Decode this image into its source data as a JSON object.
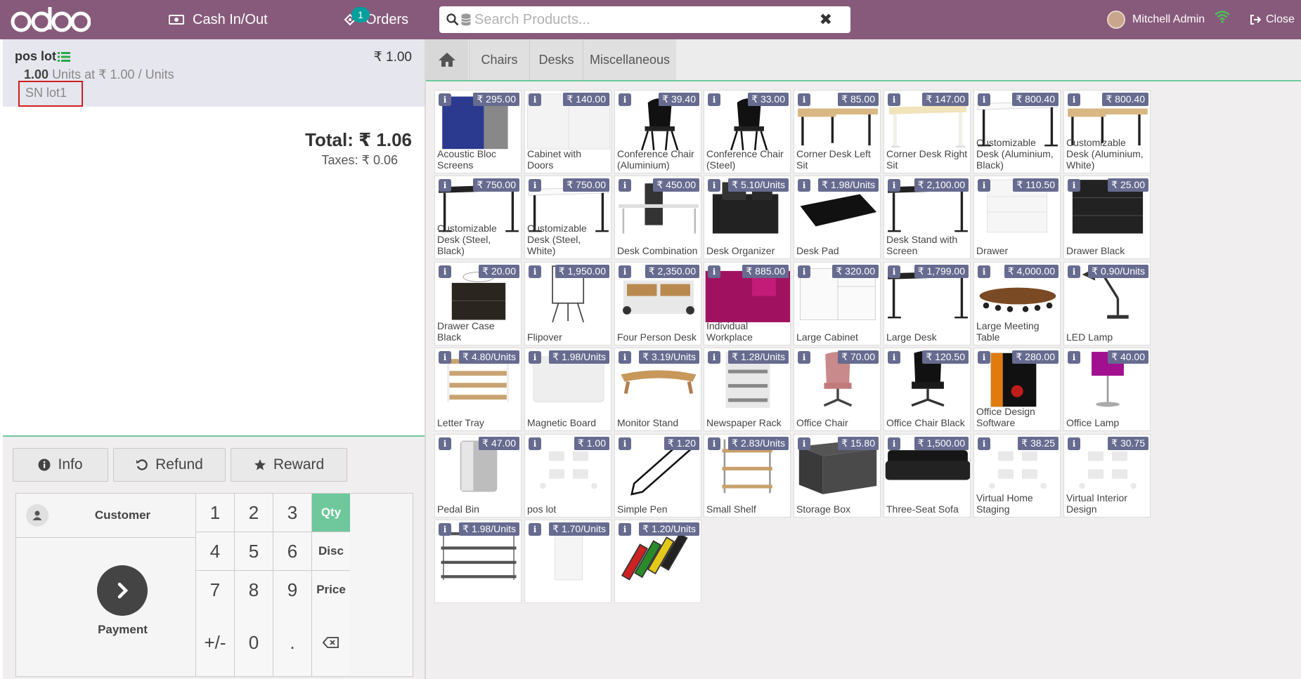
{
  "topbar": {
    "logo": "odoo",
    "cash_label": "Cash In/Out",
    "orders_label": "Orders",
    "orders_count": "1",
    "search_placeholder": "Search Products...",
    "user_name": "Mitchell Admin",
    "close_label": "Close"
  },
  "order": {
    "line": {
      "name": "pos lot",
      "price": "₹ 1.00",
      "qty": "1.00",
      "unit_info": "Units at ₹ 1.00 / Units",
      "lot": "SN lot1"
    },
    "total": "Total: ₹ 1.06",
    "taxes": "Taxes: ₹ 0.06"
  },
  "actions": {
    "info": "Info",
    "refund": "Refund",
    "reward": "Reward"
  },
  "numpad": {
    "customer": "Customer",
    "payment": "Payment",
    "keys": [
      "1",
      "2",
      "3",
      "Qty",
      "4",
      "5",
      "6",
      "Disc",
      "7",
      "8",
      "9",
      "Price",
      "+/-",
      "0",
      "."
    ]
  },
  "categories": {
    "items": [
      "Chairs",
      "Desks",
      "Miscellaneous"
    ]
  },
  "products": [
    {
      "name": "Acoustic Bloc Screens",
      "price": "₹ 295.00",
      "icon": "acoustic-screen"
    },
    {
      "name": "Cabinet with Doors",
      "price": "₹ 140.00",
      "icon": "cabinet"
    },
    {
      "name": "Conference Chair (Aluminium)",
      "price": "₹ 39.40",
      "icon": "chair"
    },
    {
      "name": "Conference Chair (Steel)",
      "price": "₹ 33.00",
      "icon": "chair"
    },
    {
      "name": "Corner Desk Left Sit",
      "price": "₹ 85.00",
      "icon": "desk-wood"
    },
    {
      "name": "Corner Desk Right Sit",
      "price": "₹ 147.00",
      "icon": "desk-light"
    },
    {
      "name": "Customizable Desk (Aluminium, Black)",
      "price": "₹ 800.40",
      "icon": "desk-white"
    },
    {
      "name": "Customizable Desk (Aluminium, White)",
      "price": "₹ 800.40",
      "icon": "desk-wood"
    },
    {
      "name": "Customizable Desk (Steel, Black)",
      "price": "₹ 750.00",
      "icon": "desk-black"
    },
    {
      "name": "Customizable Desk (Steel, White)",
      "price": "₹ 750.00",
      "icon": "desk-white"
    },
    {
      "name": "Desk Combination",
      "price": "₹ 450.00",
      "icon": "desk-combo"
    },
    {
      "name": "Desk Organizer",
      "price": "₹ 5.10/Units",
      "icon": "organizer"
    },
    {
      "name": "Desk Pad",
      "price": "₹ 1.98/Units",
      "icon": "deskpad"
    },
    {
      "name": "Desk Stand with Screen",
      "price": "₹ 2,100.00",
      "icon": "desk-black"
    },
    {
      "name": "Drawer",
      "price": "₹ 110.50",
      "icon": "drawer-white"
    },
    {
      "name": "Drawer Black",
      "price": "₹ 25.00",
      "icon": "drawer-black"
    },
    {
      "name": "Drawer Case Black",
      "price": "₹ 20.00",
      "icon": "drawer-case"
    },
    {
      "name": "Flipover",
      "price": "₹ 1,950.00",
      "icon": "flipover"
    },
    {
      "name": "Four Person Desk",
      "price": "₹ 2,350.00",
      "icon": "four-desk"
    },
    {
      "name": "Individual Workplace",
      "price": "₹ 885.00",
      "icon": "workplace"
    },
    {
      "name": "Large Cabinet",
      "price": "₹ 320.00",
      "icon": "large-cabinet"
    },
    {
      "name": "Large Desk",
      "price": "₹ 1,799.00",
      "icon": "desk-black"
    },
    {
      "name": "Large Meeting Table",
      "price": "₹ 4,000.00",
      "icon": "meeting"
    },
    {
      "name": "LED Lamp",
      "price": "₹ 0.90/Units",
      "icon": "lamp"
    },
    {
      "name": "Letter Tray",
      "price": "₹ 4.80/Units",
      "icon": "tray"
    },
    {
      "name": "Magnetic Board",
      "price": "₹ 1.98/Units",
      "icon": "board"
    },
    {
      "name": "Monitor Stand",
      "price": "₹ 3.19/Units",
      "icon": "monitor-stand"
    },
    {
      "name": "Newspaper Rack",
      "price": "₹ 1.28/Units",
      "icon": "rack"
    },
    {
      "name": "Office Chair",
      "price": "₹ 70.00",
      "icon": "office-chair-pink"
    },
    {
      "name": "Office Chair Black",
      "price": "₹ 120.50",
      "icon": "office-chair-black"
    },
    {
      "name": "Office Design Software",
      "price": "₹ 280.00",
      "icon": "software"
    },
    {
      "name": "Office Lamp",
      "price": "₹ 40.00",
      "icon": "office-lamp"
    },
    {
      "name": "Pedal Bin",
      "price": "₹ 47.00",
      "icon": "bin"
    },
    {
      "name": "pos lot",
      "price": "₹ 1.00",
      "icon": "placeholder"
    },
    {
      "name": "Simple Pen",
      "price": "₹ 1.20",
      "icon": "pen"
    },
    {
      "name": "Small Shelf",
      "price": "₹ 2.83/Units",
      "icon": "shelf"
    },
    {
      "name": "Storage Box",
      "price": "₹ 15.80",
      "icon": "storage-box"
    },
    {
      "name": "Three-Seat Sofa",
      "price": "₹ 1,500.00",
      "icon": "sofa"
    },
    {
      "name": "Virtual Home Staging",
      "price": "₹ 38.25",
      "icon": "placeholder"
    },
    {
      "name": "Virtual Interior Design",
      "price": "₹ 30.75",
      "icon": "placeholder"
    },
    {
      "name": "",
      "price": "₹ 1.98/Units",
      "icon": "wire-shelf"
    },
    {
      "name": "",
      "price": "₹ 1.70/Units",
      "icon": "whiteboard-stand"
    },
    {
      "name": "",
      "price": "₹ 1.20/Units",
      "icon": "markers"
    }
  ],
  "colors": {
    "brand": "#875a7b",
    "accent": "#6ec89b",
    "price_tag": "#666b8f",
    "highlight": "#d01f1f"
  }
}
